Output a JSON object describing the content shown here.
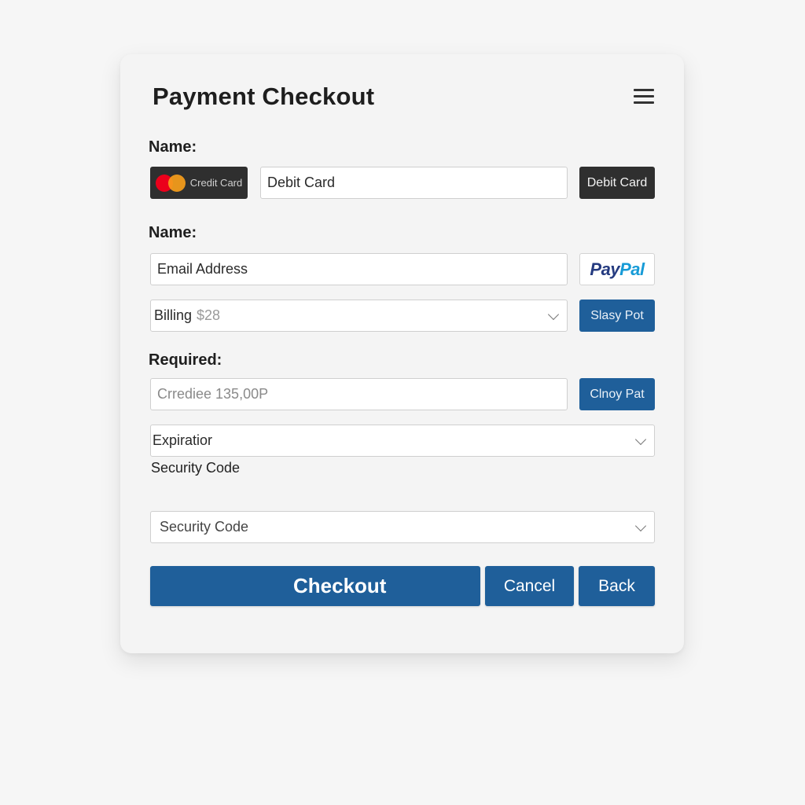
{
  "header": {
    "title": "Payment Checkout",
    "menu_icon": "hamburger-menu-icon"
  },
  "section1": {
    "label": "Name:",
    "credit_card_button": {
      "label": "Credit Card",
      "icon": "mastercard-logo-icon"
    },
    "debit_input_value": "Debit Card",
    "debit_button_label": "Debit Card"
  },
  "section2": {
    "label": "Name:",
    "email_input_value": "Email Address",
    "paypal_button": {
      "part1": "Pay",
      "part2": "Pal"
    },
    "billing_select": {
      "value": "Billing",
      "amount": "$28"
    },
    "side_button_label": "Slasy Pot"
  },
  "section3": {
    "label": "Required:",
    "credit_input_value": "Crrediee 135,00P",
    "side_button_label": "Clnoy Pat",
    "expiration_select_value": "Expiratior",
    "security_label": "Security Code",
    "security_select_value": "Security Code"
  },
  "actions": {
    "checkout": "Checkout",
    "cancel": "Cancel",
    "back": "Back"
  },
  "colors": {
    "primary": "#1f5f9a",
    "dark_button": "#2f2f2f",
    "background": "#f6f6f6",
    "card": "#f4f4f4"
  }
}
